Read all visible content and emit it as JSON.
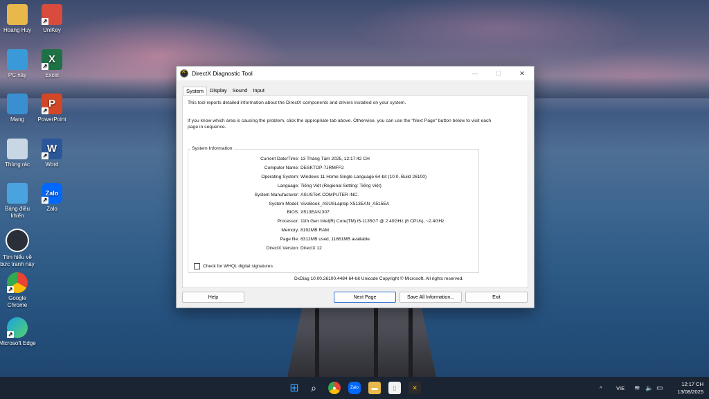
{
  "desktop": {
    "icons": [
      {
        "label": "Hoang Huy",
        "icon": "folder-user-icon",
        "color": "#e8b94a"
      },
      {
        "label": "UniKey",
        "icon": "unikey-icon",
        "color": "#d94b3c"
      },
      {
        "label": "PC này",
        "icon": "monitor-icon",
        "color": "#3a9ad9"
      },
      {
        "label": "Excel",
        "icon": "excel-icon",
        "color": "#1e7145"
      },
      {
        "label": "Mạng",
        "icon": "network-icon",
        "color": "#3a8fd0"
      },
      {
        "label": "PowerPoint",
        "icon": "powerpoint-icon",
        "color": "#d24726"
      },
      {
        "label": "Thùng rác",
        "icon": "recycle-bin-icon",
        "color": "#c9d6e3"
      },
      {
        "label": "Word",
        "icon": "word-icon",
        "color": "#2b579a"
      },
      {
        "label": "Bảng điều khiển",
        "icon": "control-panel-icon",
        "color": "#4aa3df"
      },
      {
        "label": "Zalo",
        "icon": "zalo-icon",
        "color": "#0068ff"
      },
      {
        "label": "Tìm hiểu về bức tranh này",
        "icon": "learn-about-picture-icon",
        "color": "#2a2f3a"
      },
      {
        "label": "Google Chrome",
        "icon": "chrome-icon",
        "color": "#4285f4"
      },
      {
        "label": "Microsoft Edge",
        "icon": "edge-icon",
        "color": "#1ba1e2"
      }
    ],
    "glyphs": {
      "excel": "X",
      "powerpoint": "P",
      "word": "W",
      "zalo": "Zalo",
      "shortcut_arrow": "↗"
    }
  },
  "dialog": {
    "title": "DirectX Diagnostic Tool",
    "controls": {
      "minimize": "—",
      "maximize": "☐",
      "close": "✕"
    },
    "tabs": [
      "System",
      "Display",
      "Sound",
      "Input"
    ],
    "intro1": "This tool reports detailed information about the DirectX components and drivers installed on your system.",
    "intro2": "If you know which area is causing the problem, click the appropriate tab above. Otherwise, you can use the \"Next Page\" button below to visit each page in sequence.",
    "group_title": "System Information",
    "system_info": [
      {
        "label": "Current Date/Time:",
        "value": "13 Tháng Tám 2025, 12:17:42 CH"
      },
      {
        "label": "Computer Name:",
        "value": "DESKTOP-7JRMFF2"
      },
      {
        "label": "Operating System:",
        "value": "Windows 11 Home Single Language 64-bit (10.0, Build 26100)"
      },
      {
        "label": "Language:",
        "value": "Tiếng Việt (Regional Setting: Tiếng Việt)"
      },
      {
        "label": "System Manufacturer:",
        "value": "ASUSTeK COMPUTER INC."
      },
      {
        "label": "System Model:",
        "value": "VivoBook_ASUSLaptop X513EAN_A515EA"
      },
      {
        "label": "BIOS:",
        "value": "X513EAN.307"
      },
      {
        "label": "Processor:",
        "value": "11th Gen Intel(R) Core(TM) i5-1135G7 @ 2.40GHz (8 CPUs), ~2.4GHz"
      },
      {
        "label": "Memory:",
        "value": "8192MB RAM"
      },
      {
        "label": "Page file:",
        "value": "8312MB used, 11861MB available"
      },
      {
        "label": "DirectX Version:",
        "value": "DirectX 12"
      }
    ],
    "whql_label": "Check for WHQL digital signatures",
    "copyright": "DxDiag 10.00.26100.4484 64-bit Unicode  Copyright © Microsoft. All rights reserved.",
    "buttons": {
      "help": "Help",
      "next": "Next Page",
      "save": "Save All Information...",
      "exit": "Exit"
    }
  },
  "taskbar": {
    "apps": [
      {
        "name": "start-button",
        "icon": "windows-start-icon",
        "glyph": "⊞",
        "color": "#3aa0ff"
      },
      {
        "name": "search-button",
        "icon": "search-icon",
        "glyph": "⌕",
        "color": "#1b2433"
      },
      {
        "name": "chrome-taskbar",
        "icon": "chrome-icon",
        "glyph": "●",
        "color": "#4285f4"
      },
      {
        "name": "zalo-taskbar",
        "icon": "zalo-icon",
        "glyph": "Zalo",
        "color": "#0068ff"
      },
      {
        "name": "file-explorer-taskbar",
        "icon": "folder-icon",
        "glyph": "▬",
        "color": "#e8b94a"
      },
      {
        "name": "notepad-taskbar",
        "icon": "document-icon",
        "glyph": "▯",
        "color": "#f2f2f2"
      },
      {
        "name": "dxdiag-taskbar",
        "icon": "directx-icon",
        "glyph": "✕",
        "color": "#2b2b2b"
      }
    ],
    "tray": {
      "chevron": "^",
      "lang": "VIE",
      "wifi": "≋",
      "volume": "🔈",
      "battery": "▭"
    },
    "time": "12:17 CH",
    "date": "13/08/2025"
  }
}
